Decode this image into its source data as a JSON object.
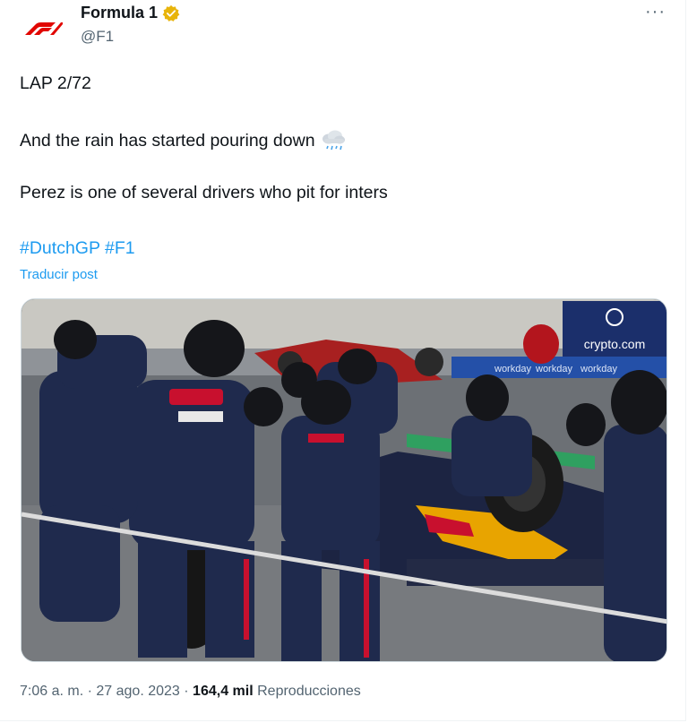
{
  "account": {
    "name": "Formula 1",
    "handle": "@F1",
    "verified_badge_color": "#e8b40a"
  },
  "post": {
    "line1": "LAP 2/72",
    "line2": "And the rain has started pouring down",
    "line2_emoji": "cloud-with-rain-icon",
    "line3": "Perez is one of several drivers who pit for inters",
    "hashtags": [
      "#DutchGP",
      "#F1"
    ],
    "translate_label": "Traducir post"
  },
  "media": {
    "sponsor_logo_text": "crypto.com",
    "banner_texts": [
      "workday",
      "workday",
      "workday"
    ]
  },
  "meta": {
    "time": "7:06 a. m.",
    "separator": "·",
    "date": "27 ago. 2023",
    "views_count": "164,4 mil",
    "views_label": "Reproducciones"
  },
  "colors": {
    "link": "#1d9bf0",
    "secondary_text": "#536471",
    "brand_red": "#e10600"
  }
}
